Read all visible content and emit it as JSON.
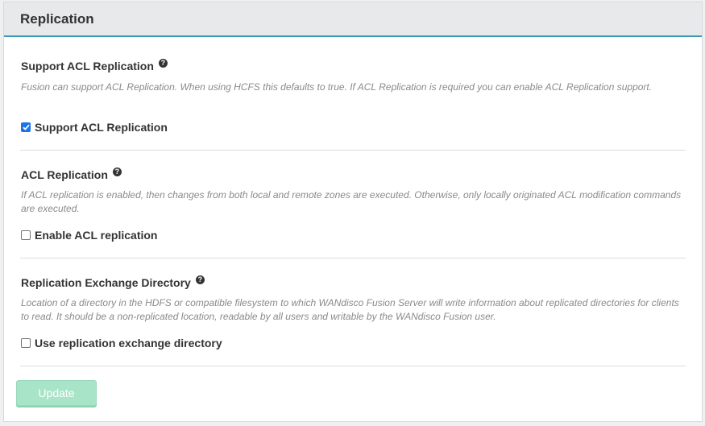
{
  "panel": {
    "title": "Replication"
  },
  "sections": [
    {
      "title": "Support ACL Replication",
      "description": "Fusion can support ACL Replication. When using HCFS this defaults to true. If ACL Replication is required you can enable ACL Replication support.",
      "checkbox_label": "Support ACL Replication",
      "checked": true
    },
    {
      "title": "ACL Replication",
      "description": "If ACL replication is enabled, then changes from both local and remote zones are executed. Otherwise, only locally originated ACL modification commands are executed.",
      "checkbox_label": "Enable ACL replication",
      "checked": false
    },
    {
      "title": "Replication Exchange Directory",
      "description": "Location of a directory in the HDFS or compatible filesystem to which WANdisco Fusion Server will write information about replicated directories for clients to read. It should be a non-replicated location, readable by all users and writable by the WANdisco Fusion user.",
      "checkbox_label": "Use replication exchange directory",
      "checked": false
    }
  ],
  "help_icon_glyph": "?",
  "update_button": {
    "label": "Update",
    "enabled": false
  },
  "colors": {
    "header_accent": "#3a9ab5",
    "checkbox_checked": "#1a73e8",
    "button_disabled": "#a8e4c8"
  }
}
